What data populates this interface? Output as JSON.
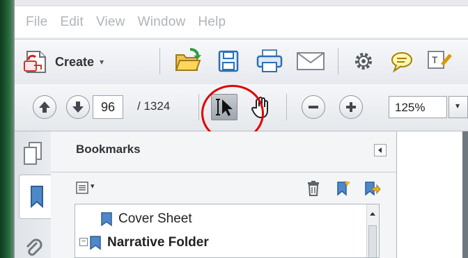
{
  "menubar": {
    "items": [
      "File",
      "Edit",
      "View",
      "Window",
      "Help"
    ]
  },
  "toolbar": {
    "create_label": "Create",
    "create_caret": "▾"
  },
  "navigation": {
    "page_value": "96",
    "page_total": "/ 1324",
    "zoom_value": "125%",
    "zoom_caret": "▾"
  },
  "panel": {
    "title": "Bookmarks",
    "options_caret": "▾",
    "bookmarks": [
      {
        "label": "Cover Sheet",
        "bold": false
      },
      {
        "label": "Narrative Folder",
        "bold": true,
        "expander": "−"
      }
    ]
  },
  "colors": {
    "highlight": "#e00000",
    "accent_blue": "#2b6fb5",
    "desktop_green": "#1e5b32"
  }
}
